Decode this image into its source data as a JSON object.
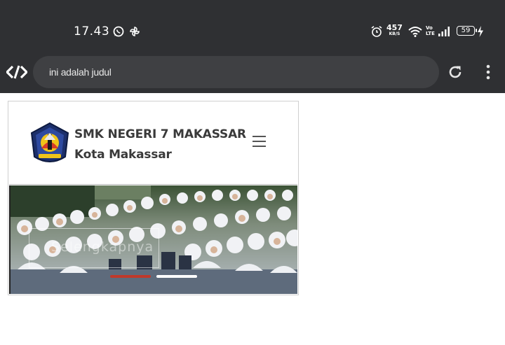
{
  "status_bar": {
    "time": "17.43",
    "net_speed_value": "457",
    "net_speed_unit": "KB/S",
    "volte_line1": "Vo",
    "volte_line2": "LTE",
    "battery_level": "59",
    "icons": [
      "whatsapp-icon",
      "pinwheel-icon",
      "alarm-icon",
      "wifi-icon",
      "signal-icon",
      "battery-icon",
      "charging-icon"
    ]
  },
  "browser": {
    "url_text": "ini adalah judul",
    "icons": [
      "browser-logo-icon",
      "reload-icon",
      "overflow-menu-icon"
    ]
  },
  "site": {
    "school_name": "SMK NEGERI 7 MAKASSAR",
    "city": "Kota Makassar",
    "hero_caption": "Selengkapnya",
    "slider_indicators": [
      {
        "color": "#c0392b",
        "active": true
      },
      {
        "color": "#ffffff",
        "active": false
      }
    ]
  },
  "colors": {
    "status_bar_bg": "#2f3033",
    "url_bar_bg": "#3f4043",
    "heading_text": "#3a3a3a"
  }
}
